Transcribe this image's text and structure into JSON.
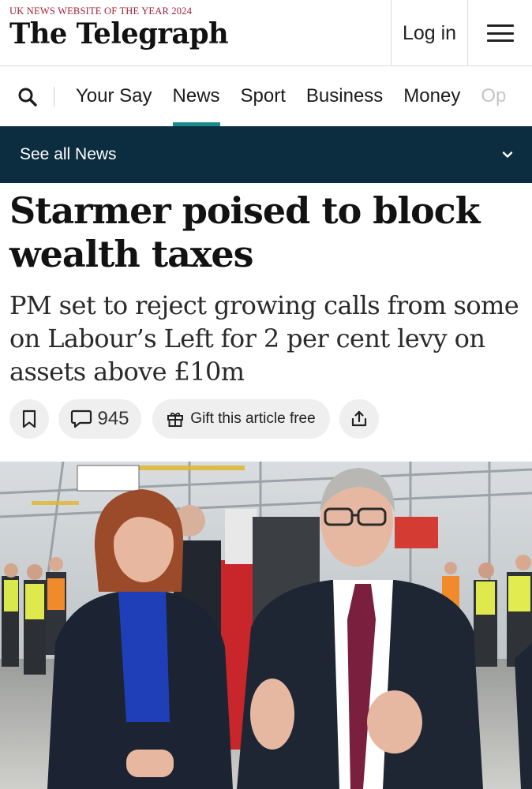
{
  "header": {
    "award": "UK NEWS WEBSITE OF THE YEAR 2024",
    "masthead": "The Telegraph",
    "login_label": "Log in",
    "menu_icon": "hamburger-icon"
  },
  "nav": {
    "search_icon": "search-icon",
    "items": [
      {
        "label": "Your Say"
      },
      {
        "label": "News"
      },
      {
        "label": "Sport"
      },
      {
        "label": "Business"
      },
      {
        "label": "Money"
      },
      {
        "label": "Op"
      }
    ],
    "active_item": "News"
  },
  "section_bar": {
    "label": "See all News",
    "icon": "chevron-down-icon"
  },
  "article": {
    "headline": "Starmer poised to block wealth taxes",
    "standfirst": "PM set to reject growing calls from some on Labour’s Left for 2 per cent levy on assets above £10m",
    "comment_count": "945",
    "gift_label": "Gift this article free"
  },
  "colors": {
    "award_red": "#a31f34",
    "section_bar_bg": "#0c2d40",
    "active_underline": "#1a8a8a",
    "pill_bg": "#efefef"
  }
}
